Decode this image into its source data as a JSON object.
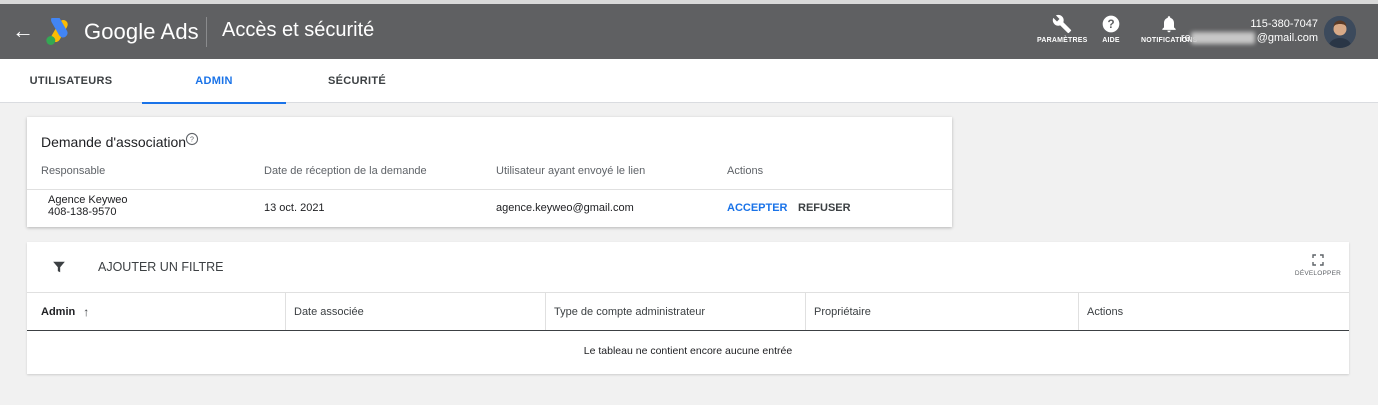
{
  "header": {
    "back_icon": "arrow-left-icon",
    "product_name": "Google Ads",
    "page_title": "Accès et sécurité",
    "tools": [
      {
        "label": "PARAMÈTRES",
        "icon": "wrench-icon"
      },
      {
        "label": "AIDE",
        "icon": "help-circle-icon"
      },
      {
        "label": "NOTIFICATIONS",
        "icon": "bell-icon"
      }
    ],
    "account_id": "115-380-7047",
    "account_email_prefix": "re",
    "account_email_suffix": "@gmail.com"
  },
  "tabs": [
    {
      "label": "UTILISATEURS",
      "active": false
    },
    {
      "label": "ADMIN",
      "active": true
    },
    {
      "label": "SÉCURITÉ",
      "active": false
    }
  ],
  "association_request": {
    "title": "Demande d'association",
    "columns": [
      "Responsable",
      "Date de réception de la demande",
      "Utilisateur ayant envoyé le lien",
      "Actions"
    ],
    "row": {
      "manager_name": "Agence Keyweo",
      "manager_id": "408-138-9570",
      "date": "13 oct. 2021",
      "sender": "agence.keyweo@gmail.com",
      "accept_label": "ACCEPTER",
      "refuse_label": "REFUSER"
    }
  },
  "admin_table": {
    "filter_label": "AJOUTER UN FILTRE",
    "expand_label": "DÉVELOPPER",
    "columns": [
      "Admin",
      "Date associée",
      "Type de compte administrateur",
      "Propriétaire",
      "Actions"
    ],
    "empty_message": "Le tableau ne contient encore aucune entrée"
  },
  "colors": {
    "header_bg": "#5f6062",
    "accent": "#1a73e8",
    "page_bg": "#f1f1f1"
  }
}
